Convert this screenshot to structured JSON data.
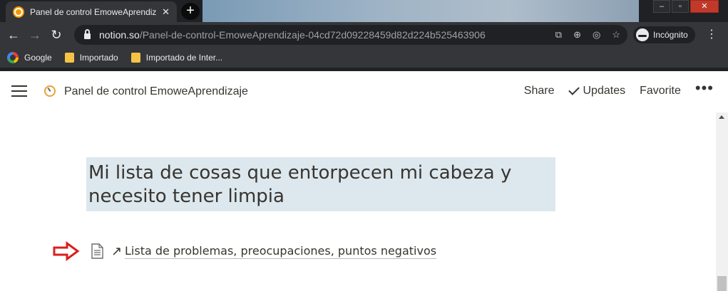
{
  "browser": {
    "active_tab": {
      "title": "Panel de control EmoweAprendiz"
    },
    "new_tab_label": "+",
    "address": {
      "host": "notion.so",
      "path": "/Panel-de-control-EmoweAprendizaje-04cd72d09228459d82d224b525463906"
    },
    "profile_label": "Incógnito",
    "bookmarks": [
      "Google",
      "Importado",
      "Importado de Inter..."
    ]
  },
  "notion": {
    "breadcrumb": "Panel de control EmoweAprendizaje",
    "actions": {
      "share": "Share",
      "updates": "Updates",
      "favorite": "Favorite",
      "more": "•••"
    },
    "heading": "Mi lista de cosas que entorpecen mi cabeza y necesito tener limpia",
    "link_arrow": "↗",
    "linked_page": "Lista de problemas, preocupaciones, puntos negativos"
  },
  "colors": {
    "heading_background": "#dde7ee",
    "annotation_arrow": "#d9201c",
    "text": "#37352f"
  },
  "icons": [
    "notion-page-icon",
    "hamburger-icon",
    "check-icon",
    "document-icon",
    "red-arrow-annotation"
  ]
}
